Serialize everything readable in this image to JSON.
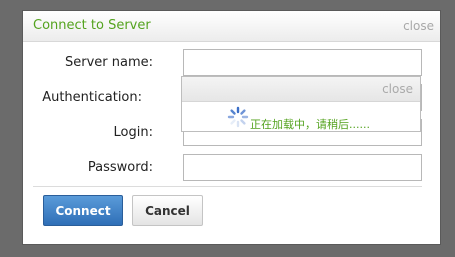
{
  "dialog": {
    "title": "Connect to Server",
    "close_label": "close"
  },
  "form": {
    "server_name_label": "Server name:",
    "authentication_label": "Authentication:",
    "login_label": "Login:",
    "password_label": "Password:",
    "server_name_value": "",
    "login_value": "",
    "password_value": ""
  },
  "buttons": {
    "connect_label": "Connect",
    "cancel_label": "Cancel"
  },
  "loading": {
    "close_label": "close",
    "message": "正在加载中，请稍后......"
  },
  "colors": {
    "title_color": "#54a31f",
    "primary_button": "#3a7cc4",
    "backdrop": "#6b6b6b"
  },
  "icons": {
    "spinner": "loading-spinner-icon"
  }
}
